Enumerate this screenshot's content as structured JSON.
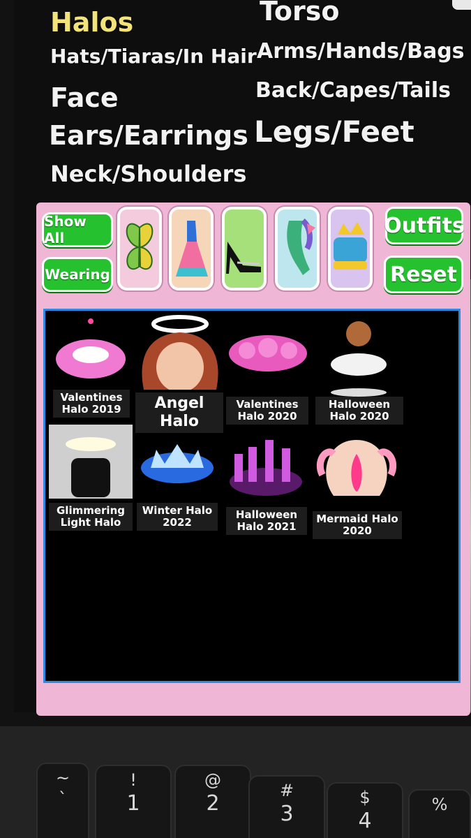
{
  "categories": {
    "halos": "Halos",
    "hats": "Hats/Tiaras/In Hair",
    "face": "Face",
    "ears": "Ears/Earrings",
    "neck": "Neck/Shoulders",
    "torso": "Torso",
    "arms": "Arms/Hands/Bags",
    "back": "Back/Capes/Tails",
    "legs": "Legs/Feet"
  },
  "toolbar": {
    "show_all": "Show All",
    "wearing": "Wearing",
    "outfits": "Outfits",
    "reset": "Reset"
  },
  "category_icons": [
    "butterfly-wings-icon",
    "dress-icon",
    "heels-icon",
    "mermaid-tail-icon",
    "crown-icon"
  ],
  "items": [
    {
      "name": "Valentines Halo 2019"
    },
    {
      "name": "Angel Halo"
    },
    {
      "name": "Valentines Halo 2020"
    },
    {
      "name": "Halloween Halo 2020"
    },
    {
      "name": "Glimmering Light Halo"
    },
    {
      "name": "Winter Halo 2022"
    },
    {
      "name": "Halloween Halo 2021"
    },
    {
      "name": "Mermaid Halo 2020"
    }
  ],
  "keyboard": {
    "keys": [
      {
        "top": "~",
        "bottom": "`"
      },
      {
        "top": "!",
        "bottom": "1"
      },
      {
        "top": "@",
        "bottom": "2"
      },
      {
        "top": "#",
        "bottom": "3"
      },
      {
        "top": "$",
        "bottom": "4"
      },
      {
        "top": "%",
        "bottom": ""
      }
    ]
  },
  "colors": {
    "active_category": "#f2e27a",
    "button_green": "#26c12e",
    "panel_pink": "#efb6d6",
    "grid_border": "#2b8be0"
  }
}
